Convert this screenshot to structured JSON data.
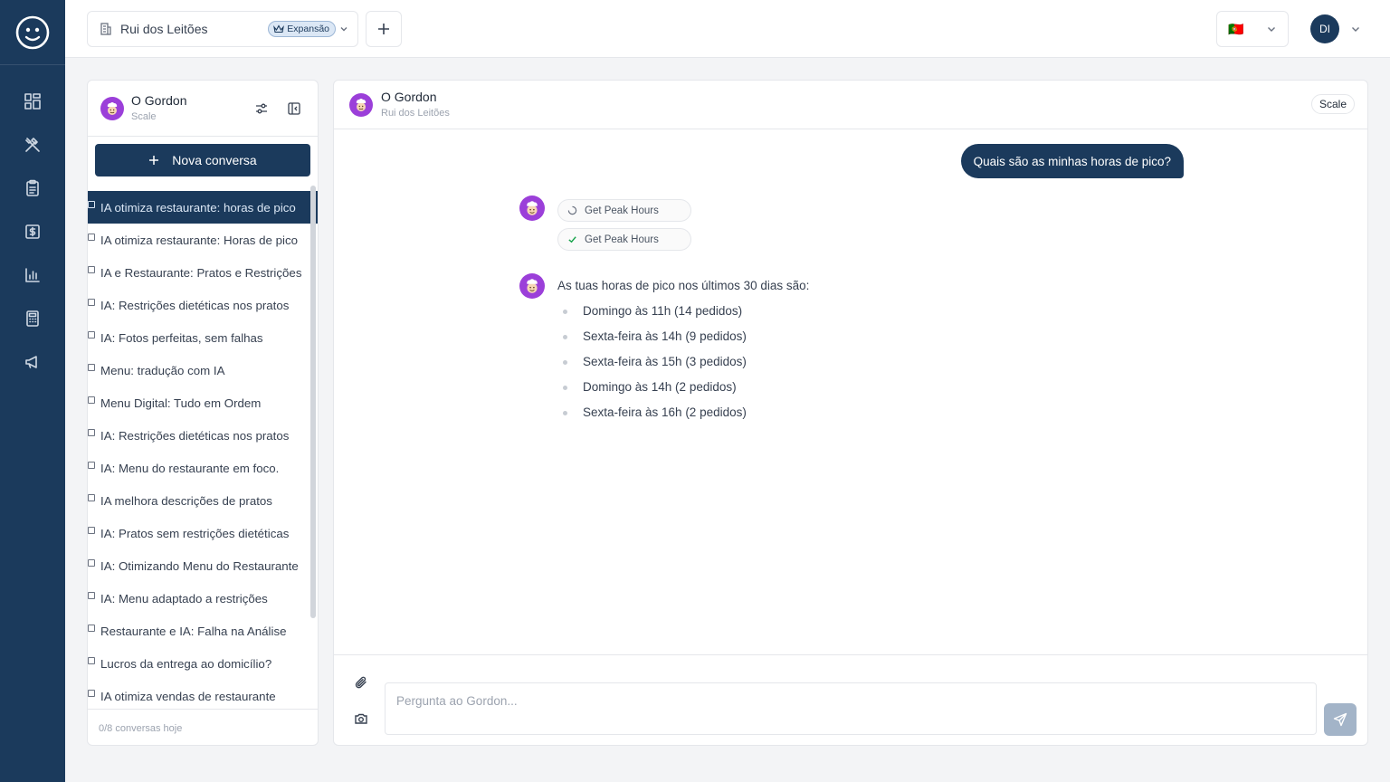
{
  "sidebar_nav": {
    "logo_icon": "smiley-chef-logo-icon",
    "items": [
      {
        "icon": "dashboard-grid-icon"
      },
      {
        "icon": "utensils-icon"
      },
      {
        "icon": "clipboard-icon"
      },
      {
        "icon": "dollar-icon"
      },
      {
        "icon": "bar-chart-icon"
      },
      {
        "icon": "calculator-icon"
      },
      {
        "icon": "megaphone-icon"
      }
    ]
  },
  "topbar": {
    "restaurant_name": "Rui dos Leitões",
    "plan_badge": "Expansão",
    "language_flag": "🇵🇹",
    "user_initials": "DI"
  },
  "conversations": {
    "assistant_name": "O Gordon",
    "plan": "Scale",
    "new_conversation_label": "Nova conversa",
    "items": [
      "IA otimiza restaurante: horas de pico",
      "IA otimiza restaurante: Horas de pico",
      "IA e Restaurante: Pratos e Restrições",
      "IA: Restrições dietéticas nos pratos",
      "IA: Fotos perfeitas, sem falhas",
      "Menu: tradução com IA",
      "Menu Digital: Tudo em Ordem",
      "IA: Restrições dietéticas nos pratos",
      "IA: Menu do restaurante em foco.",
      "IA melhora descrições de pratos",
      "IA: Pratos sem restrições dietéticas",
      "IA: Otimizando Menu do Restaurante",
      "IA: Menu adaptado a restrições",
      "Restaurante e IA: Falha na Análise",
      "Lucros da entrega ao domicílio?",
      "IA otimiza vendas de restaurante"
    ],
    "footer": "0/8 conversas hoje"
  },
  "chat": {
    "assistant_name": "O Gordon",
    "restaurant": "Rui dos Leitões",
    "plan": "Scale",
    "user_message": "Quais são as minhas horas de pico?",
    "tool_calls": [
      {
        "label": "Get Peak Hours",
        "status": "loading"
      },
      {
        "label": "Get Peak Hours",
        "status": "done"
      }
    ],
    "answer_intro": "As tuas horas de pico nos últimos 30 dias são:",
    "answer_items": [
      "Domingo às 11h (14 pedidos)",
      "Sexta-feira às 14h (9 pedidos)",
      "Sexta-feira às 15h (3 pedidos)",
      "Domingo às 14h (2 pedidos)",
      "Sexta-feira às 16h (2 pedidos)"
    ],
    "input_placeholder": "Pergunta ao Gordon..."
  },
  "colors": {
    "brand_navy": "#1b3a5c",
    "bot_purple": "#9b3fd9",
    "send_disabled": "#a3b4c8"
  }
}
